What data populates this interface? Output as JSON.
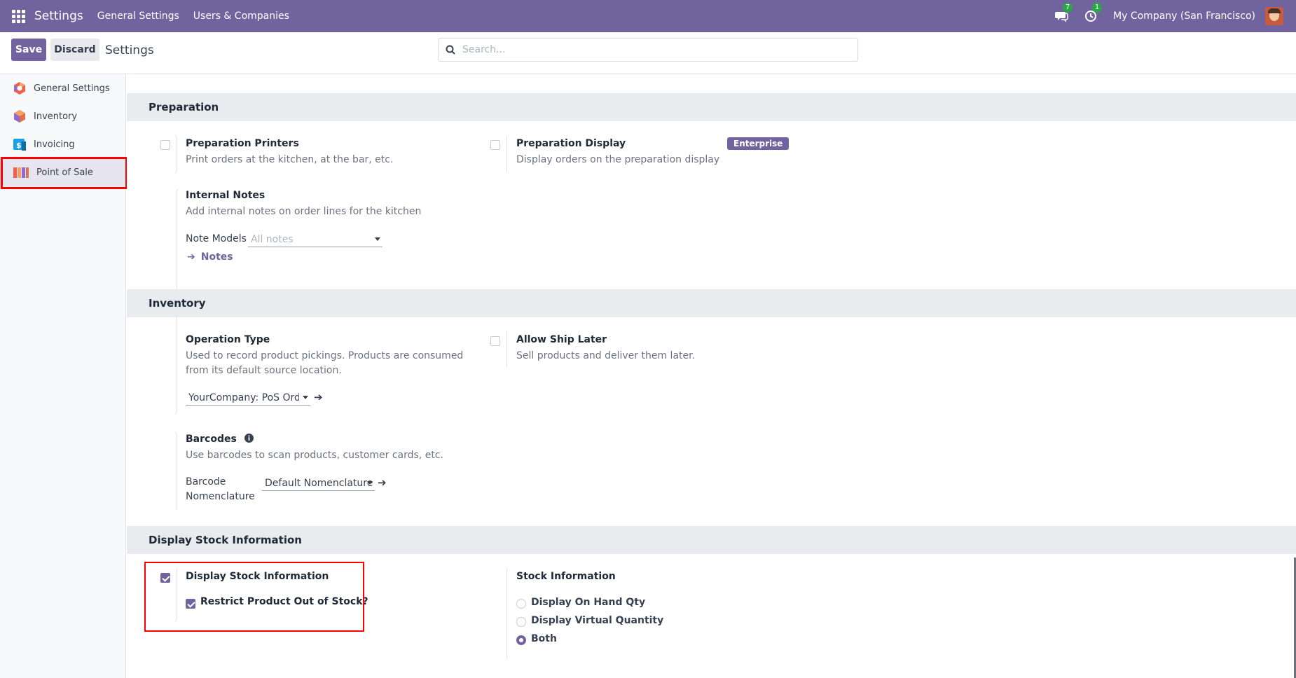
{
  "navbar": {
    "app_title": "Settings",
    "menu": [
      "General Settings",
      "Users & Companies"
    ],
    "messages_count": "7",
    "activities_count": "1",
    "company": "My Company (San Francisco)"
  },
  "control_panel": {
    "save_label": "Save",
    "discard_label": "Discard",
    "breadcrumb": "Settings",
    "search_placeholder": "Search..."
  },
  "sidebar": {
    "items": [
      {
        "label": "General Settings",
        "icon": "general-settings-icon"
      },
      {
        "label": "Inventory",
        "icon": "inventory-icon"
      },
      {
        "label": "Invoicing",
        "icon": "invoicing-icon"
      },
      {
        "label": "Point of Sale",
        "icon": "point-of-sale-icon",
        "active": true
      }
    ]
  },
  "sections": {
    "preparation": {
      "title": "Preparation",
      "printers": {
        "label": "Preparation Printers",
        "desc": "Print orders at the kitchen, at the bar, etc.",
        "checked": false
      },
      "display": {
        "label": "Preparation Display",
        "desc": "Display orders on the preparation display",
        "badge": "Enterprise",
        "checked": false
      },
      "internal_notes": {
        "label": "Internal Notes",
        "desc": "Add internal notes on order lines for the kitchen",
        "field_label": "Note Models",
        "field_placeholder": "All notes",
        "link": "Notes"
      }
    },
    "inventory": {
      "title": "Inventory",
      "operation_type": {
        "label": "Operation Type",
        "desc": "Used to record product pickings. Products are consumed from its default source location.",
        "value": "YourCompany: PoS Orders"
      },
      "ship_later": {
        "label": "Allow Ship Later",
        "desc": "Sell products and deliver them later.",
        "checked": false
      },
      "barcodes": {
        "label": "Barcodes",
        "desc": "Use barcodes to scan products, customer cards, etc.",
        "field_label": "Barcode Nomenclature",
        "value": "Default Nomenclature"
      }
    },
    "stock": {
      "title": "Display Stock Information",
      "display_stock": {
        "label": "Display Stock Information",
        "checked": true
      },
      "restrict": {
        "label": "Restrict Product Out of Stock?",
        "checked": true
      },
      "stock_info": {
        "label": "Stock Information",
        "options": [
          {
            "label": "Display On Hand Qty",
            "checked": false
          },
          {
            "label": "Display Virtual Quantity",
            "checked": false
          },
          {
            "label": "Both",
            "checked": true
          }
        ]
      }
    }
  },
  "colors": {
    "brand": "#71639e",
    "badge": "#28a745",
    "highlight": "#ff0000"
  }
}
